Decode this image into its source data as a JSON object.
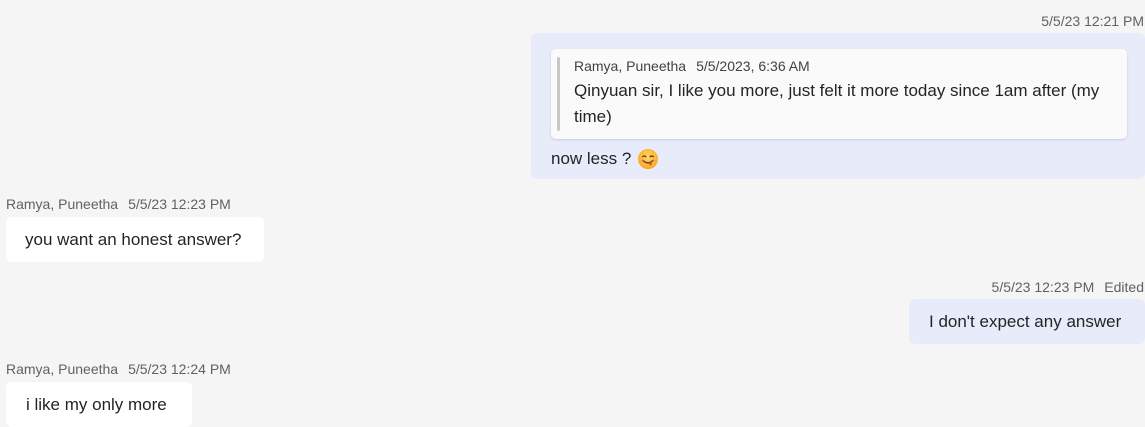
{
  "messages": [
    {
      "id": "msg1",
      "timestamp": "5/5/23 12:21 PM",
      "quote": {
        "sender": "Ramya, Puneetha",
        "time": "5/5/2023, 6:36 AM",
        "text": "Qinyuan sir, I like you more, just felt it more today since 1am after (my time)"
      },
      "text": "now less ?",
      "emoji": "face-savoring-food-emoji"
    },
    {
      "id": "msg2",
      "sender": "Ramya, Puneetha",
      "timestamp": "5/5/23 12:23 PM",
      "text": "you want an honest answer?"
    },
    {
      "id": "msg3",
      "timestamp": "5/5/23 12:23 PM",
      "edited": "Edited",
      "text": "I don't expect any answer"
    },
    {
      "id": "msg4",
      "sender": "Ramya, Puneetha",
      "timestamp": "5/5/23 12:24 PM",
      "text": "i like my only more"
    }
  ],
  "colors": {
    "background": "#f5f5f5",
    "mine_bubble": "#e8ebfa",
    "theirs_bubble": "#ffffff",
    "meta_text": "#616161"
  }
}
